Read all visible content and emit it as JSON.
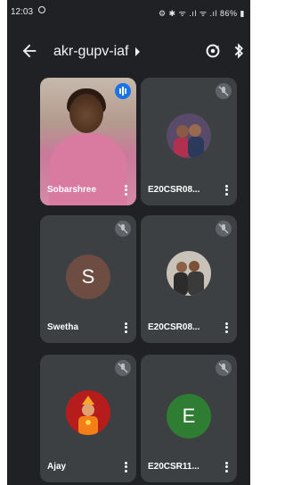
{
  "status_bar": {
    "time": "12:03",
    "right_text": "⚙ ✱ ᯤ .ıl ᯤ .ıl 86% ▮"
  },
  "app_bar": {
    "meeting_code": "akr-gupv-iaf"
  },
  "colors": {
    "background": "#202124",
    "tile": "#3c4043",
    "speaking_indicator": "#1a73e8",
    "muted_indicator": "#5f6368",
    "avatar_s": "#6d4c41",
    "avatar_e": "#2e7d32"
  },
  "participants": [
    {
      "name": "Sobarshree",
      "avatar": "video-feed",
      "mic": "speaking"
    },
    {
      "name": "E20CSR08...",
      "avatar": "photo-couple",
      "mic": "muted"
    },
    {
      "name": "Swetha",
      "avatar_letter": "S",
      "mic": "muted"
    },
    {
      "name": "E20CSR08...",
      "avatar": "photo-group",
      "mic": "muted"
    },
    {
      "name": "Ajay",
      "avatar": "photo-deity",
      "mic": "muted"
    },
    {
      "name": "E20CSR11...",
      "avatar_letter": "E",
      "mic": "muted"
    }
  ]
}
